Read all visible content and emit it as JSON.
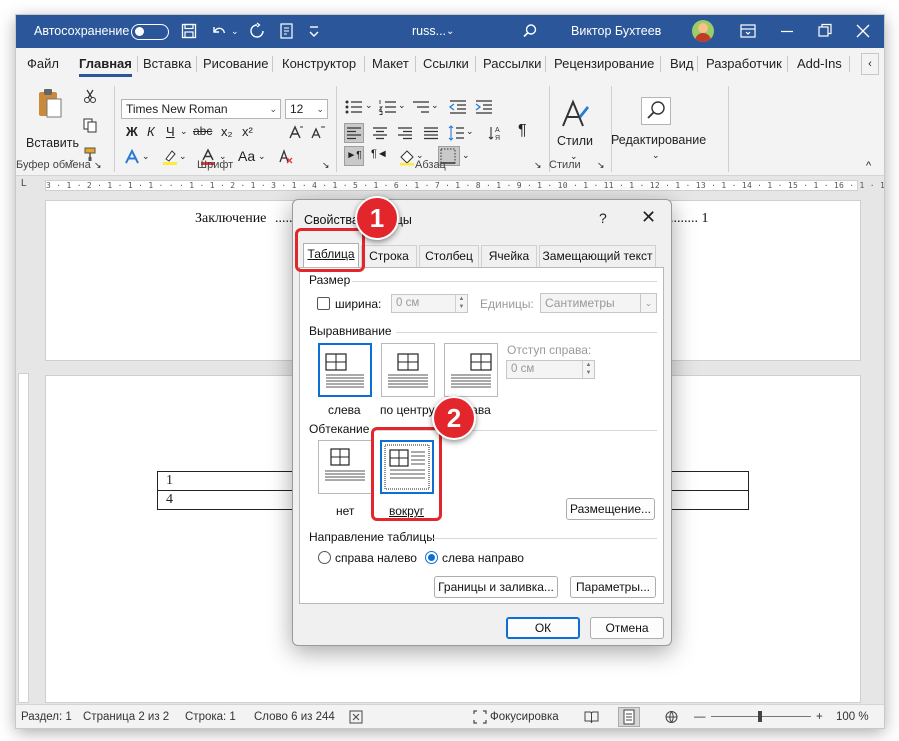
{
  "titlebar": {
    "autosave_label": "Автосохранение",
    "doc_name": "russ...",
    "doc_dropdown": "⌄",
    "user_name": "Виктор Бухтеев"
  },
  "ribbon_tabs": [
    "Файл",
    "Главная",
    "Вставка",
    "Рисование",
    "Конструктор",
    "Макет",
    "Ссылки",
    "Рассылки",
    "Рецензирование",
    "Вид",
    "Разработчик",
    "Add-Ins"
  ],
  "ribbon": {
    "paste_label": "Вставить",
    "font_name": "Times New Roman",
    "font_size": "12",
    "bold": "Ж",
    "italic": "К",
    "underline": "Ч",
    "strike": "abc",
    "subscript": "x₂",
    "superscript": "x²",
    "styles_label": "Стили",
    "editing_label": "Редактирование",
    "group_clipboard": "Буфер обмена",
    "group_font": "Шрифт",
    "group_paragraph": "Абзац",
    "group_styles": "Стили"
  },
  "ruler_text": "3 · 1 · 2 · 1 · 1 · 1 ·  ·  · 1 · 1 · 2 · 1 · 3 · 1 · 4 · 1 · 5 · 1 · 6 · 1 · 7 · 1 · 8 · 1 · 9 · 1 · 10 · 1 · 11 · 1 · 12 · 1 · 13 · 1 · 14 · 1 · 15 · 1 · 16 · 1 · 17 · 1 · 18 ·",
  "document": {
    "toc_text": "Заключение",
    "toc_dots_left": ".....",
    "toc_dots_right": "................ 1",
    "table_rows": [
      [
        "1",
        ""
      ],
      [
        "4",
        ""
      ]
    ]
  },
  "statusbar": {
    "section": "Раздел: 1",
    "page": "Страница 2 из 2",
    "line": "Строка: 1",
    "words": "Слово 6 из 244",
    "focus": "Фокусировка",
    "zoom": "100 %",
    "zoom_minus": "—",
    "zoom_plus": "+"
  },
  "dialog": {
    "title": "Свойства таблицы",
    "help": "?",
    "close": "✕",
    "tabs": [
      "Таблица",
      "Строка",
      "Столбец",
      "Ячейка",
      "Замещающий текст"
    ],
    "size_section": "Размер",
    "width_label": "ширина:",
    "width_value": "0 см",
    "units_label": "Единицы:",
    "units_value": "Сантиметры",
    "align_section": "Выравнивание",
    "align_options": [
      "слева",
      "по центру",
      "справа"
    ],
    "indent_label": "Отступ справа:",
    "indent_value": "0 см",
    "wrap_section": "Обтекание",
    "wrap_options": [
      "нет",
      "вокруг"
    ],
    "placement_button": "Размещение...",
    "direction_section": "Направление таблицы",
    "direction_options": [
      "справа налево",
      "слева направо"
    ],
    "borders_button": "Границы и заливка...",
    "params_button": "Параметры...",
    "ok": "ОК",
    "cancel": "Отмена"
  },
  "callouts": [
    "1",
    "2"
  ],
  "colors": {
    "titlebar": "#2b579a",
    "accent": "#0b6fd4",
    "callout": "#e3262c"
  },
  "icons": [
    "save-icon",
    "undo-icon",
    "redo-icon",
    "search-icon",
    "minimize-icon",
    "restore-icon",
    "close-icon",
    "paste-icon",
    "cut-icon",
    "copy-icon",
    "format-painter-icon",
    "styles-icon",
    "find-icon"
  ]
}
